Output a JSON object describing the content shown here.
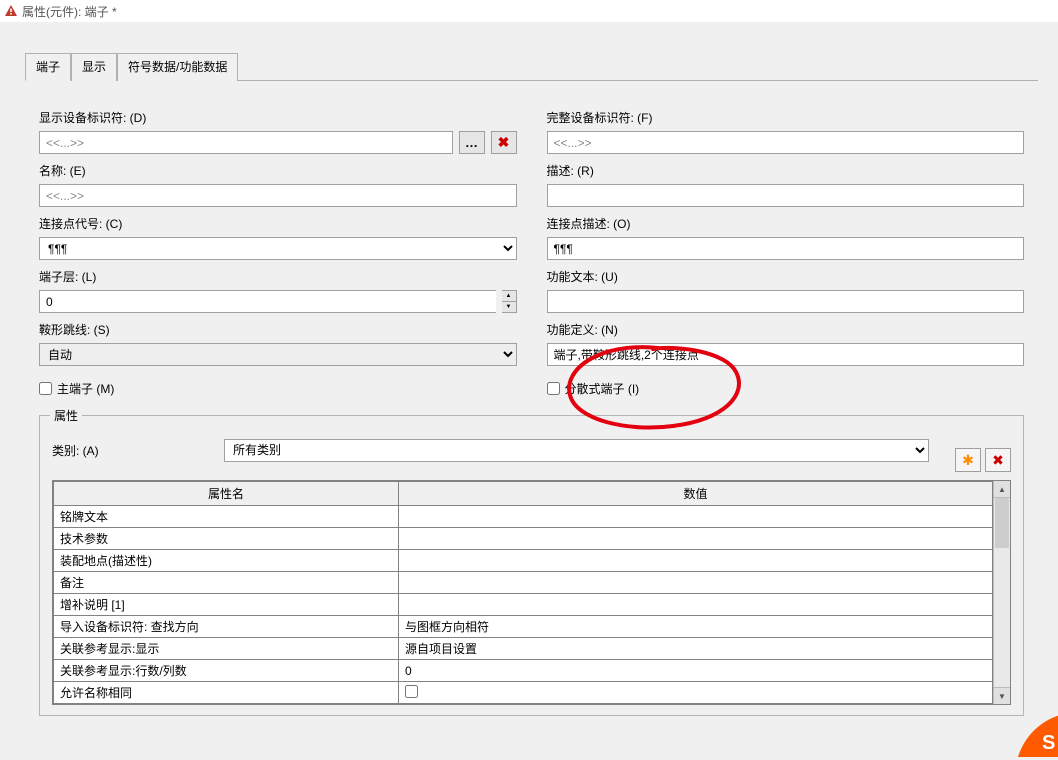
{
  "window": {
    "title": "属性(元件): 端子 *"
  },
  "tabs": [
    "端子",
    "显示",
    "符号数据/功能数据"
  ],
  "fields": {
    "display_dt": {
      "label": "显示设备标识符: (D)",
      "value": "<<...>>"
    },
    "full_dt": {
      "label": "完整设备标识符: (F)",
      "value": "<<...>>"
    },
    "name": {
      "label": "名称: (E)",
      "value": "<<...>>"
    },
    "desc": {
      "label": "描述: (R)",
      "value": ""
    },
    "conn_code": {
      "label": "连接点代号: (C)",
      "value": "¶¶¶"
    },
    "conn_desc": {
      "label": "连接点描述: (O)",
      "value": "¶¶¶"
    },
    "layer": {
      "label": "端子层: (L)",
      "value": "0"
    },
    "func_text": {
      "label": "功能文本: (U)",
      "value": ""
    },
    "saddle": {
      "label": "鞍形跳线: (S)",
      "value": "自动"
    },
    "func_def": {
      "label": "功能定义: (N)",
      "value": "端子,带鞍形跳线,2个连接点"
    }
  },
  "checkboxes": {
    "main": {
      "label": "主端子 (M)",
      "checked": false
    },
    "distributed": {
      "label": "分散式端子 (I)",
      "checked": false
    }
  },
  "group": {
    "title": "属性"
  },
  "category": {
    "label": "类别: (A)",
    "value": "所有类别"
  },
  "table": {
    "columns": [
      "属性名",
      "数值"
    ],
    "rows": [
      {
        "name": "铭牌文本",
        "value": ""
      },
      {
        "name": "技术参数",
        "value": ""
      },
      {
        "name": "装配地点(描述性)",
        "value": ""
      },
      {
        "name": "备注",
        "value": ""
      },
      {
        "name": "增补说明 [1]",
        "value": ""
      },
      {
        "name": "导入设备标识符: 查找方向",
        "value": "与图框方向相符"
      },
      {
        "name": "关联参考显示:显示",
        "value": "源自项目设置"
      },
      {
        "name": "关联参考显示:行数/列数",
        "value": "0"
      },
      {
        "name": "允许名称相同",
        "value": "__checkbox__"
      }
    ]
  }
}
